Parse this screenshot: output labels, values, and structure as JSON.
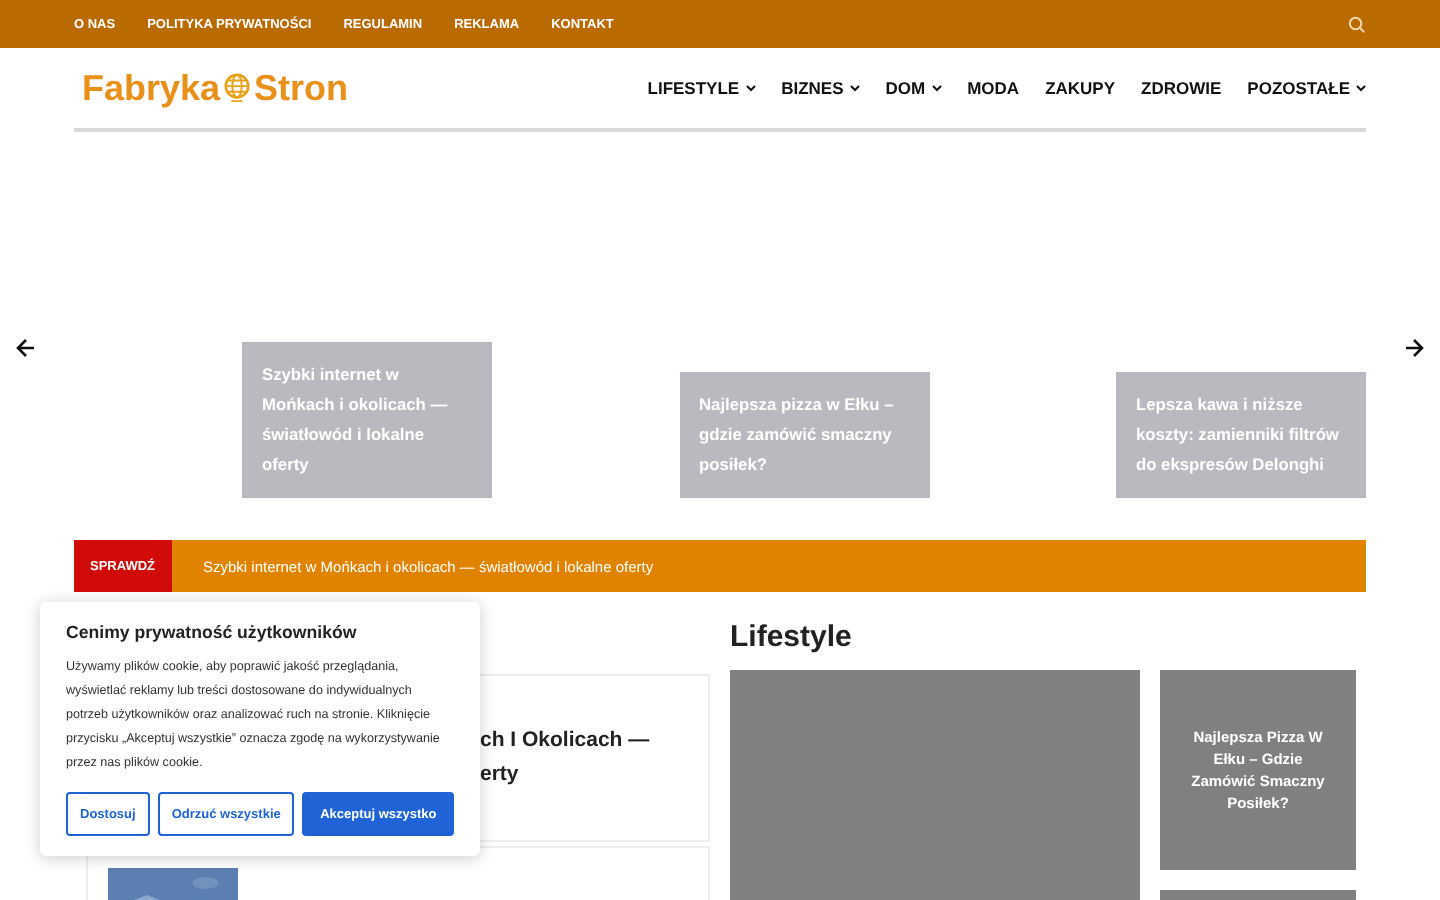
{
  "top_links": [
    "O NAS",
    "POLITYKA PRYWATNOŚCI",
    "REGULAMIN",
    "REKLAMA",
    "KONTAKT"
  ],
  "logo": {
    "left": "Fabryka",
    "right": "Stron"
  },
  "nav": [
    {
      "label": "LIFESTYLE",
      "dropdown": true
    },
    {
      "label": "BIZNES",
      "dropdown": true
    },
    {
      "label": "DOM",
      "dropdown": true
    },
    {
      "label": "MODA",
      "dropdown": false
    },
    {
      "label": "ZAKUPY",
      "dropdown": false
    },
    {
      "label": "ZDROWIE",
      "dropdown": false
    },
    {
      "label": "POZOSTAŁE",
      "dropdown": true
    }
  ],
  "slider": [
    {
      "title": "Szybki internet w Mońkach i okolicach — światłowód i lokalne oferty"
    },
    {
      "title": "Najlepsza pizza w Ełku – gdzie zamówić smaczny posiłek?"
    },
    {
      "title": "Lepsza kawa i niższe koszty: zamienniki filtrów do ekspresów Delonghi"
    }
  ],
  "ticker": {
    "label": "SPRAWDŹ",
    "text": "Szybki internet w Mońkach i okolicach — światłowód i lokalne oferty"
  },
  "left_posts": [
    {
      "title_lines": [
        "ch I Okolicach —",
        "erty"
      ]
    }
  ],
  "lifestyle": {
    "heading": "Lifestyle",
    "side_posts": [
      {
        "title": "Najlepsza Pizza W Ełku – Gdzie Zamówić Smaczny Posiłek?"
      }
    ]
  },
  "cookie": {
    "title": "Cenimy prywatność użytkowników",
    "text": "Używamy plików cookie, aby poprawić jakość przeglądania, wyświetlać reklamy lub treści dostosowane do indywidualnych potrzeb użytkowników oraz analizować ruch na stronie. Kliknięcie przycisku „Akceptuj wszystkie” oznacza zgodę na wykorzystywanie przez nas plików cookie.",
    "buttons": [
      {
        "label": "Dostosuj",
        "kind": "outline"
      },
      {
        "label": "Odrzuć wszystkie",
        "kind": "outline"
      },
      {
        "label": "Akceptuj wszystko",
        "kind": "primary"
      }
    ]
  }
}
